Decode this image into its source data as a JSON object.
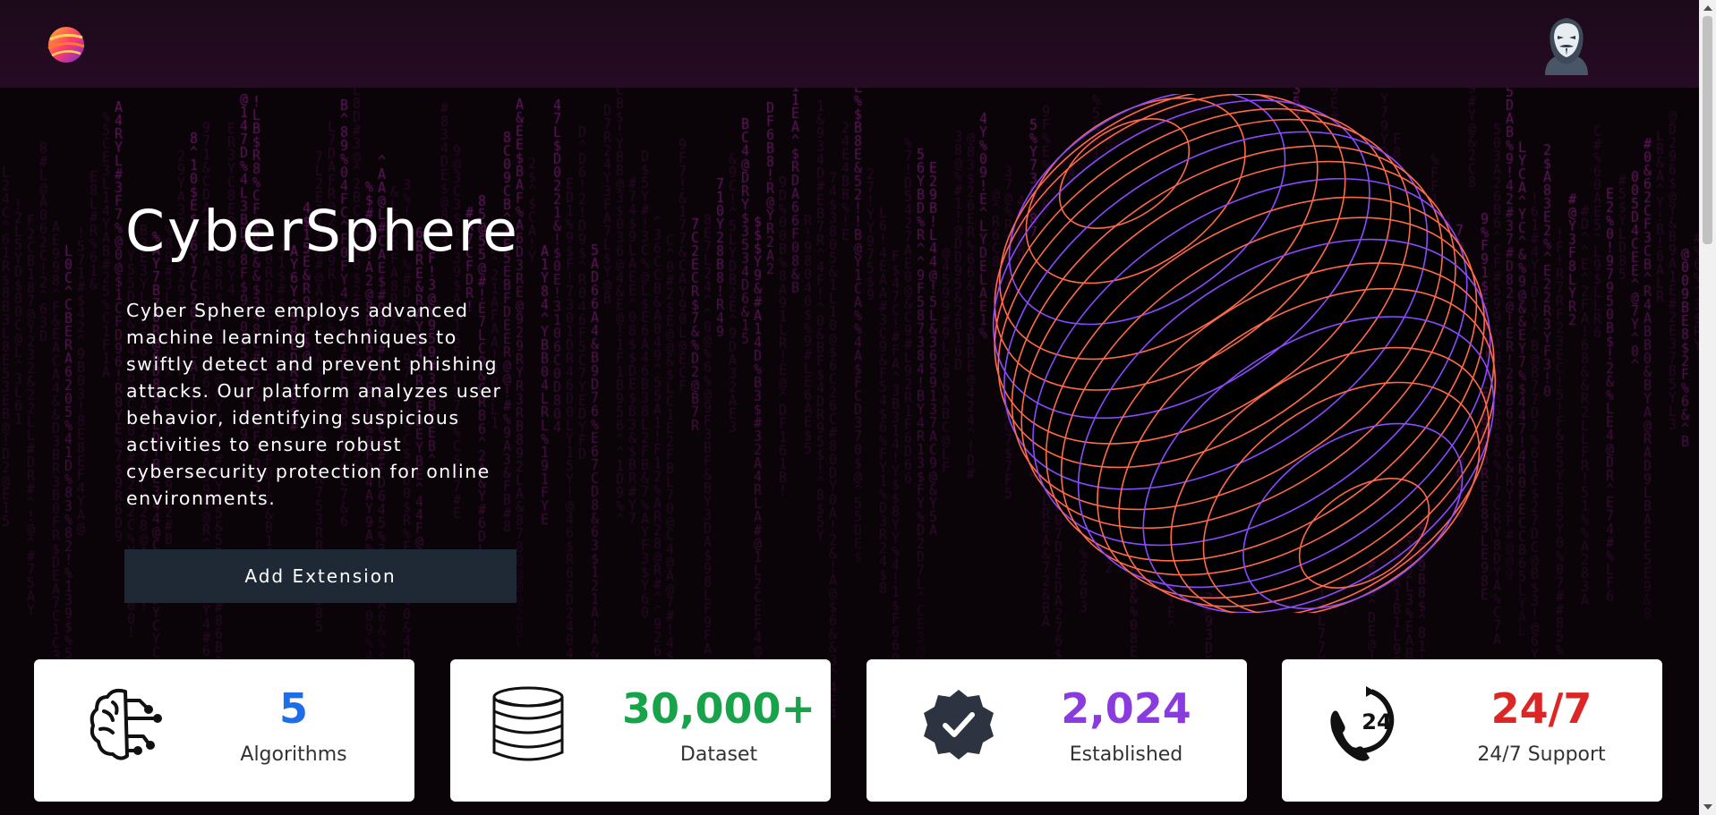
{
  "header": {
    "logo_icon": "planet-logo-icon",
    "avatar_icon": "anonymous-mask-avatar-icon"
  },
  "hero": {
    "title": "CyberSphere",
    "description": "Cyber Sphere employs advanced machine learning techniques to swiftly detect and prevent phishing attacks. Our platform analyzes user behavior, identifying suspicious activities to ensure robust cybersecurity protection for online environments.",
    "button_label": "Add Extension"
  },
  "stats": [
    {
      "icon": "brain-circuit-icon",
      "value": "5",
      "label": "Algorithms",
      "color": "#1d6ee8"
    },
    {
      "icon": "database-icon",
      "value": "30,000+",
      "label": "Dataset",
      "color": "#17a34a"
    },
    {
      "icon": "verified-badge-icon",
      "value": "2,024",
      "label": "Established",
      "color": "#8a3be0"
    },
    {
      "icon": "support-24-phone-icon",
      "value": "24/7",
      "label": "24/7 Support",
      "color": "#dc2626"
    }
  ],
  "colors": {
    "background": "#0a0409",
    "matrix_glyph": "#a0279a",
    "button": "#1e2935",
    "sphere_ring_a": "#ff6a4a",
    "sphere_ring_b": "#8a4bff"
  }
}
